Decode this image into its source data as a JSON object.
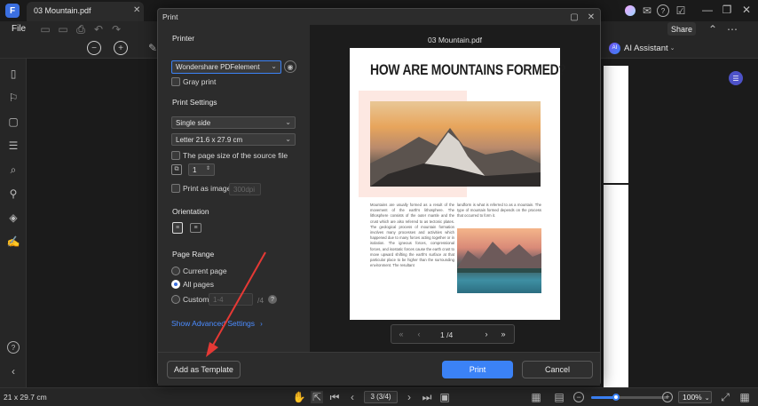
{
  "tab": {
    "title": "03 Mountain.pdf"
  },
  "menu": {
    "file": "File"
  },
  "toolbar": {
    "share": "Share",
    "ai_assistant": "AI Assistant"
  },
  "status": {
    "page_size": "21 x 29.7 cm",
    "page_counter": "3 (3/4)",
    "zoom": "100%",
    "zoom_level": 0.3
  },
  "dialog": {
    "title": "Print",
    "printer_header": "Printer",
    "printer_value": "Wondershare PDFelement",
    "gray_print": "Gray print",
    "print_settings_header": "Print Settings",
    "sides_value": "Single side",
    "paper_value": "Letter 21.6 x 27.9 cm",
    "source_size": "The page size of the source file",
    "copies": "1",
    "print_as_image": "Print as image",
    "dpi_placeholder": "300dpi",
    "orientation_header": "Orientation",
    "page_range_header": "Page Range",
    "current_page": "Current page",
    "all_pages": "All pages",
    "custom": "Custom",
    "custom_placeholder": "1-4",
    "custom_of": "/4",
    "advanced": "Show Advanced Settings",
    "add_template": "Add as Template",
    "print_btn": "Print",
    "cancel_btn": "Cancel"
  },
  "preview": {
    "file_name": "03 Mountain.pdf",
    "page_indicator": "1 /4",
    "heading": "HOW ARE MOUNTAINS FORMED?",
    "col1": "Mountains are usually formed as a result of the movement of the earth's lithosphere. The lithosphere consists of the outer mantle and the crust which are also referred to as tectonic plates. The geological process of mountain formation involves many processes and activities which happened due to many forces acting together or in isolation. The igneous forces, compressional forces, and isostatic forces cause the earth crust to move upward shifting the earth's surface at that particular place to be higher than the surrounding environment. The resultant",
    "col2": "landform is what is referred to as a mountain. The type of mountain formed depends on the process that occurred to form it."
  },
  "colors": {
    "accent": "#3b82f6",
    "arrow": "#e53935",
    "peach": "#fde8e2"
  }
}
